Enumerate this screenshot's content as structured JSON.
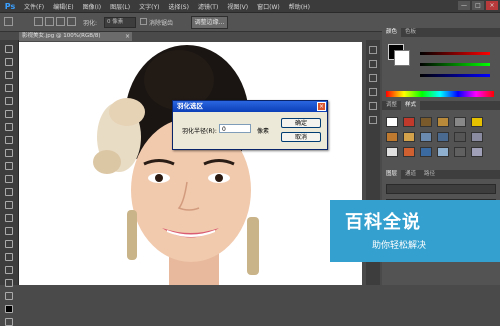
{
  "app": {
    "logo": "Ps"
  },
  "menu": [
    "文件(F)",
    "编辑(E)",
    "图像(I)",
    "图层(L)",
    "文字(Y)",
    "选择(S)",
    "滤镜(T)",
    "视图(V)",
    "窗口(W)",
    "帮助(H)"
  ],
  "window_controls": [
    "—",
    "□",
    "×"
  ],
  "options_bar": {
    "feather_label": "羽化:",
    "feather_value": "0 像素",
    "antialias_label": "消除锯齿",
    "style_label": "样式:",
    "refine_button": "调整边缘..."
  },
  "doc_tab": {
    "title": "影视美女.jpg @ 100%(RGB/8)",
    "close": "×"
  },
  "dialog": {
    "title": "羽化选区",
    "radius_label": "羽化半径(R):",
    "radius_value": "0",
    "unit": "像素",
    "ok": "确定",
    "cancel": "取消",
    "close": "×"
  },
  "panels": {
    "color_tabs": [
      "颜色",
      "色板"
    ],
    "adjust_tabs": [
      "调整",
      "样式"
    ],
    "layer_tabs": [
      "图层",
      "通道",
      "路径"
    ]
  },
  "watermark": {
    "title": "百科全说",
    "subtitle": "助你轻松解决"
  },
  "colors": {
    "accent": "#34a0cf",
    "dialog_title": "#0b3fb8"
  }
}
